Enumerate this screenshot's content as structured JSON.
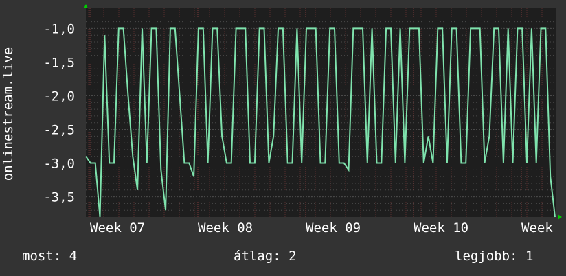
{
  "chart_data": {
    "type": "line",
    "ylabel": "onlinestream.live",
    "x_ticks": [
      "Week 07",
      "Week 08",
      "Week 09",
      "Week 10",
      "Week"
    ],
    "y_ticks": [
      "-1,0",
      "-1,5",
      "-2,0",
      "-2,5",
      "-3,0",
      "-3,5"
    ],
    "y_tick_values": [
      -1.0,
      -1.5,
      -2.0,
      -2.5,
      -3.0,
      -3.5
    ],
    "ylim": [
      -3.8,
      -0.7
    ],
    "grid": true,
    "x_range": [
      0,
      100
    ],
    "series": [
      {
        "color": "#7fe3ad",
        "values": [
          -2.9,
          -3.0,
          -3.0,
          -3.8,
          -1.1,
          -3.0,
          -3.0,
          -1.0,
          -1.0,
          -2.0,
          -2.9,
          -3.4,
          -1.0,
          -3.0,
          -1.0,
          -1.0,
          -3.1,
          -3.7,
          -1.0,
          -1.0,
          -2.0,
          -3.0,
          -3.0,
          -3.2,
          -1.0,
          -1.0,
          -3.0,
          -1.0,
          -1.0,
          -2.6,
          -3.0,
          -3.0,
          -1.0,
          -1.0,
          -1.0,
          -3.0,
          -3.0,
          -1.0,
          -1.0,
          -3.0,
          -2.6,
          -1.0,
          -1.0,
          -3.0,
          -3.0,
          -1.0,
          -3.0,
          -1.0,
          -1.0,
          -1.0,
          -3.0,
          -3.0,
          -1.0,
          -1.0,
          -3.0,
          -3.0,
          -3.1,
          -1.0,
          -1.0,
          -1.0,
          -3.0,
          -1.0,
          -3.0,
          -3.0,
          -1.0,
          -1.0,
          -3.0,
          -1.0,
          -3.0,
          -1.0,
          -1.0,
          -1.0,
          -3.0,
          -2.6,
          -3.0,
          -1.0,
          -1.0,
          -3.0,
          -1.0,
          -1.0,
          -3.0,
          -3.0,
          -1.0,
          -1.0,
          -1.0,
          -3.0,
          -2.6,
          -1.0,
          -1.0,
          -3.0,
          -1.0,
          -3.0,
          -1.0,
          -1.0,
          -3.0,
          -1.0,
          -3.0,
          -1.0,
          -1.0,
          -3.2,
          -3.8
        ]
      }
    ]
  },
  "stats": {
    "current": "most: 4",
    "average": "átlag: 2",
    "best": "legjobb: 1"
  },
  "colors": {
    "background": "#333333",
    "plot_background": "#1e1e1e",
    "grid": "#4a4a4a",
    "minor_grid": "#5a2f2f",
    "line": "#7fe3ad",
    "axis_marker": "#00cc00",
    "text": "#ffffff"
  }
}
